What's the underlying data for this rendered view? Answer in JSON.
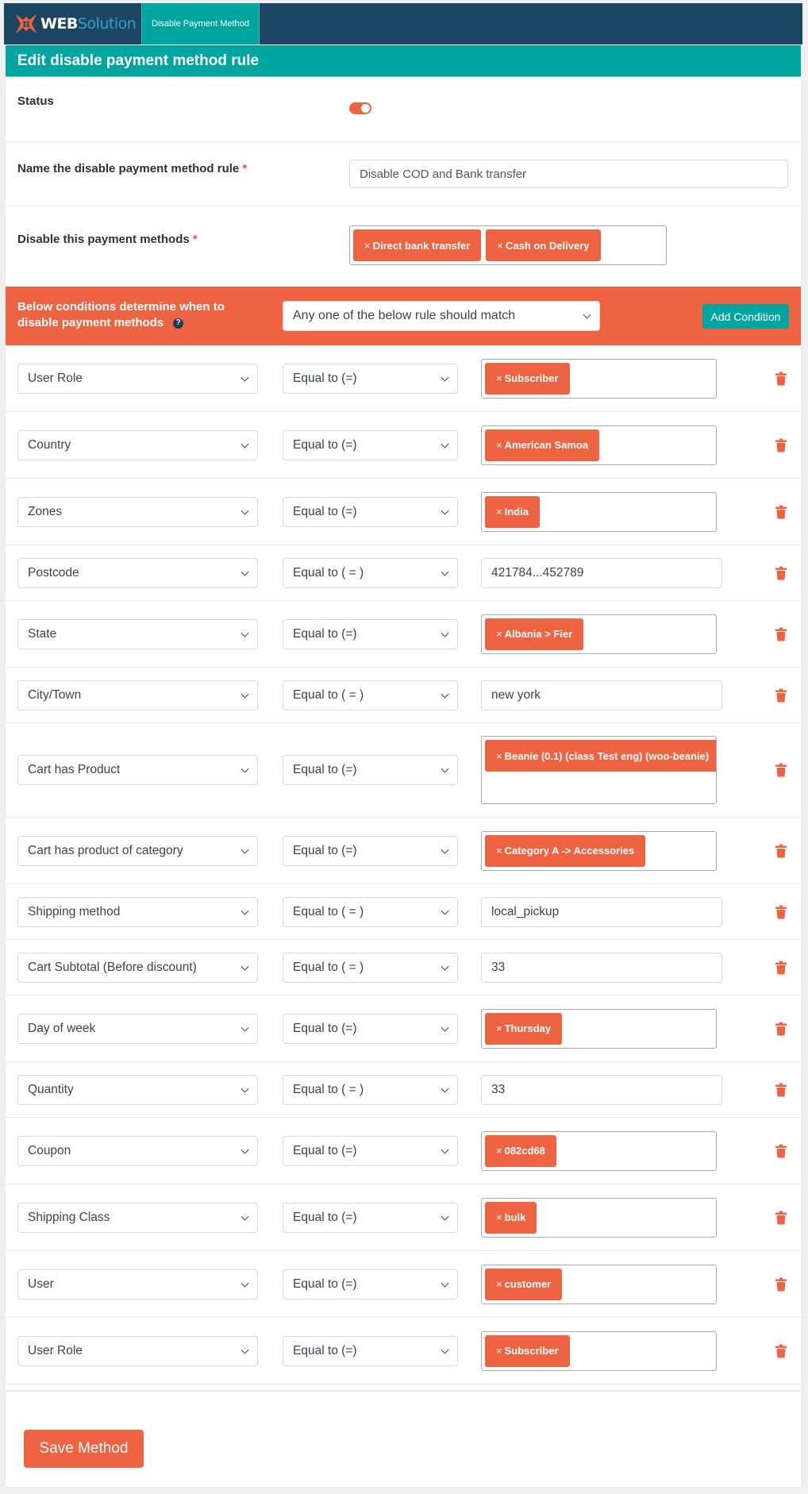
{
  "header": {
    "logo_web": "WEB",
    "logo_solution": "Solution",
    "nav_tab": "Disable Payment Method"
  },
  "page": {
    "title": "Edit disable payment method rule"
  },
  "form": {
    "status_label": "Status",
    "status_enabled": true,
    "name_label": "Name the disable payment method rule",
    "name_value": "Disable COD and Bank transfer",
    "methods_label": "Disable this payment methods",
    "required_mark": "*",
    "methods": [
      "Direct bank transfer",
      "Cash on Delivery"
    ]
  },
  "conditions": {
    "label": "Below conditions determine when to disable payment methods",
    "match_value": "Any one of the below rule should match",
    "add_button": "Add Condition",
    "help_icon": "?",
    "remove_glyph": "×",
    "rows": [
      {
        "field": "User Role",
        "operator": "Equal to (=)",
        "type": "tags",
        "values": [
          "Subscriber"
        ]
      },
      {
        "field": "Country",
        "operator": "Equal to (=)",
        "type": "tags",
        "values": [
          "American Samoa"
        ]
      },
      {
        "field": "Zones",
        "operator": "Equal to (=)",
        "type": "tags",
        "values": [
          "India"
        ]
      },
      {
        "field": "Postcode",
        "operator": "Equal to ( = )",
        "type": "text",
        "value": "421784...452789"
      },
      {
        "field": "State",
        "operator": "Equal to (=)",
        "type": "tags",
        "values": [
          "Albania > Fier"
        ]
      },
      {
        "field": "City/Town",
        "operator": "Equal to ( = )",
        "type": "text",
        "value": "new york"
      },
      {
        "field": "Cart has Product",
        "operator": "Equal to (=)",
        "type": "tags",
        "values": [
          "Beanie (0.1) (class Test eng) (woo-beanie)"
        ]
      },
      {
        "field": "Cart has product of category",
        "operator": "Equal to (=)",
        "type": "tags",
        "values": [
          "Category A -> Accessories"
        ]
      },
      {
        "field": "Shipping method",
        "operator": "Equal to ( = )",
        "type": "text",
        "value": "local_pickup"
      },
      {
        "field": "Cart Subtotal (Before discount)",
        "operator": "Equal to ( = )",
        "type": "text",
        "value": "33"
      },
      {
        "field": "Day of week",
        "operator": "Equal to (=)",
        "type": "tags",
        "values": [
          "Thursday"
        ]
      },
      {
        "field": "Quantity",
        "operator": "Equal to ( = )",
        "type": "text",
        "value": "33"
      },
      {
        "field": "Coupon",
        "operator": "Equal to (=)",
        "type": "tags",
        "values": [
          "082cd68"
        ]
      },
      {
        "field": "Shipping Class",
        "operator": "Equal to (=)",
        "type": "tags",
        "values": [
          "bulk"
        ]
      },
      {
        "field": "User",
        "operator": "Equal to (=)",
        "type": "tags",
        "values": [
          "customer"
        ]
      },
      {
        "field": "User Role",
        "operator": "Equal to (=)",
        "type": "tags",
        "values": [
          "Subscriber"
        ]
      }
    ]
  },
  "footer": {
    "save_button": "Save Method"
  },
  "colors": {
    "navy": "#1b4563",
    "teal": "#00a59f",
    "orange": "#ee6341"
  }
}
